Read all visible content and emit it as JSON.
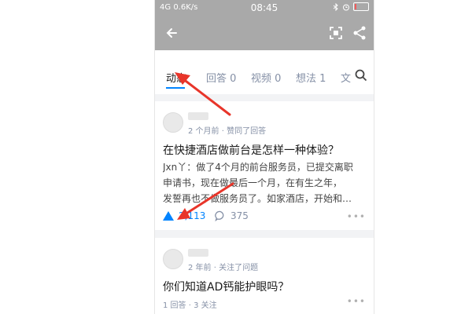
{
  "status_bar": {
    "signal": "4G",
    "speed": "0.6K/s",
    "time": "08:45",
    "battery_level": 0.1
  },
  "tabs": [
    {
      "label": "动态"
    },
    {
      "label": "回答 0"
    },
    {
      "label": "视频 0"
    },
    {
      "label": "想法 1"
    },
    {
      "label": "文"
    }
  ],
  "feed": [
    {
      "meta": "2 个月前 · 赞同了回答",
      "title": "在快捷酒店做前台是怎样一种体验？",
      "excerpt_lines": [
        "Jxn丫：做了4个月的前台服务员，已提交离职",
        "申请书，现在做最后一个月，在有生之年，",
        "发誓再也不做服务员了。如家酒店，开始和…"
      ],
      "votes": "2,113",
      "comments": "375",
      "more": "•••"
    },
    {
      "meta": "2 年前 · 关注了问题",
      "title": "你们知道AD钙能护眼吗？",
      "stats": "1 回答 · 3 关注",
      "more": "•••"
    }
  ],
  "colors": {
    "accent": "#0084ff",
    "annotation": "#e8352a",
    "toolbar": "#a9a9a9"
  }
}
